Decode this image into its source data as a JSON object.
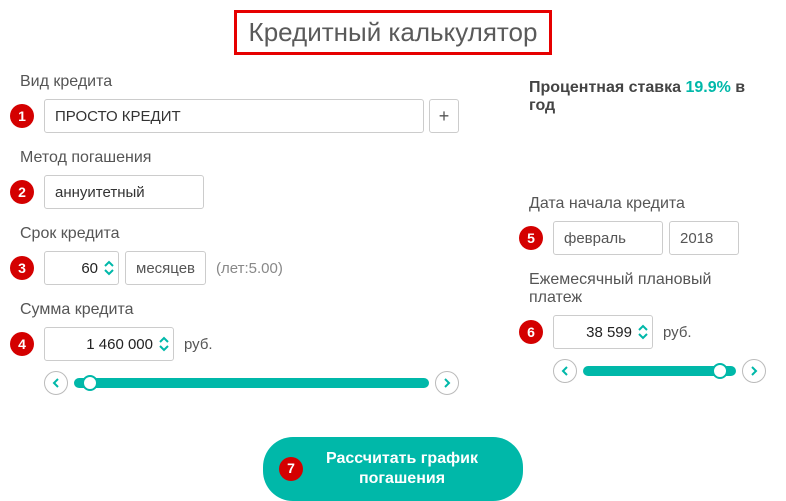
{
  "title": "Кредитный калькулятор",
  "badges": {
    "b1": "1",
    "b2": "2",
    "b3": "3",
    "b4": "4",
    "b5": "5",
    "b6": "6",
    "b7": "7"
  },
  "creditType": {
    "label": "Вид кредита",
    "value": "ПРОСТО КРЕДИТ",
    "plus": "+"
  },
  "rate": {
    "prefix": "Процентная ставка ",
    "value": "19.9%",
    "suffix": " в год"
  },
  "method": {
    "label": "Метод погашения",
    "value": "аннуитетный"
  },
  "term": {
    "label": "Срок кредита",
    "value": "60",
    "unit": "месяцев",
    "hint": "(лет:5.00)"
  },
  "startDate": {
    "label": "Дата начала кредита",
    "month": "февраль",
    "year": "2018"
  },
  "amount": {
    "label": "Сумма кредита",
    "value": "1 460 000",
    "unit": "руб."
  },
  "payment": {
    "label": "Ежемесячный плановый платеж",
    "value": "38 599",
    "unit": "руб."
  },
  "calcButton": "Рассчитать график погашения"
}
